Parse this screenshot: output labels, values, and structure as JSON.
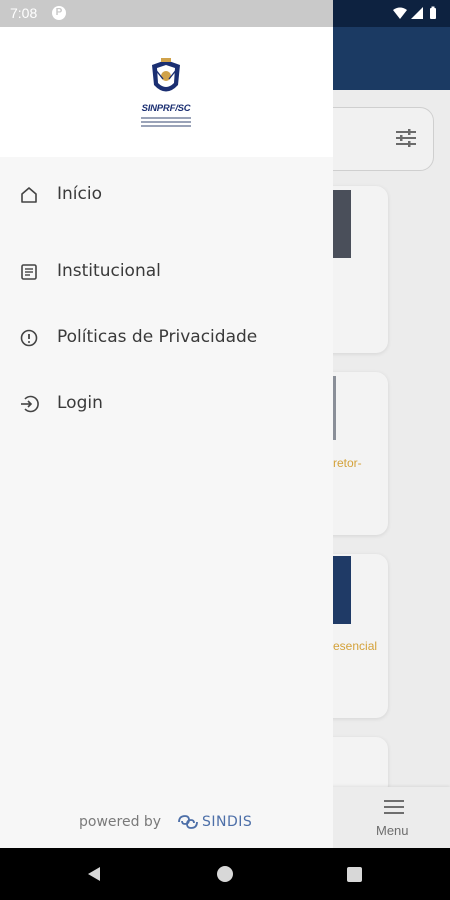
{
  "status_bar": {
    "time": "7:08",
    "notification_icon": "P"
  },
  "logo": {
    "text": "SINPRF/SC"
  },
  "drawer": {
    "items": [
      {
        "label": "Início",
        "icon": "home-icon"
      },
      {
        "label": "Institucional",
        "icon": "document-icon"
      },
      {
        "label": "Políticas de Privacidade",
        "icon": "info-circle-icon"
      },
      {
        "label": "Login",
        "icon": "login-arrow-icon"
      }
    ],
    "powered_by": "powered by",
    "brand": "SINDIS"
  },
  "background": {
    "card_snippets": [
      "retor-",
      "esencial"
    ],
    "menu_label": "Menu"
  },
  "colors": {
    "header_blue": "#1b3a63",
    "accent_text": "#d4a23a",
    "drawer_bg": "#f7f7f7"
  }
}
